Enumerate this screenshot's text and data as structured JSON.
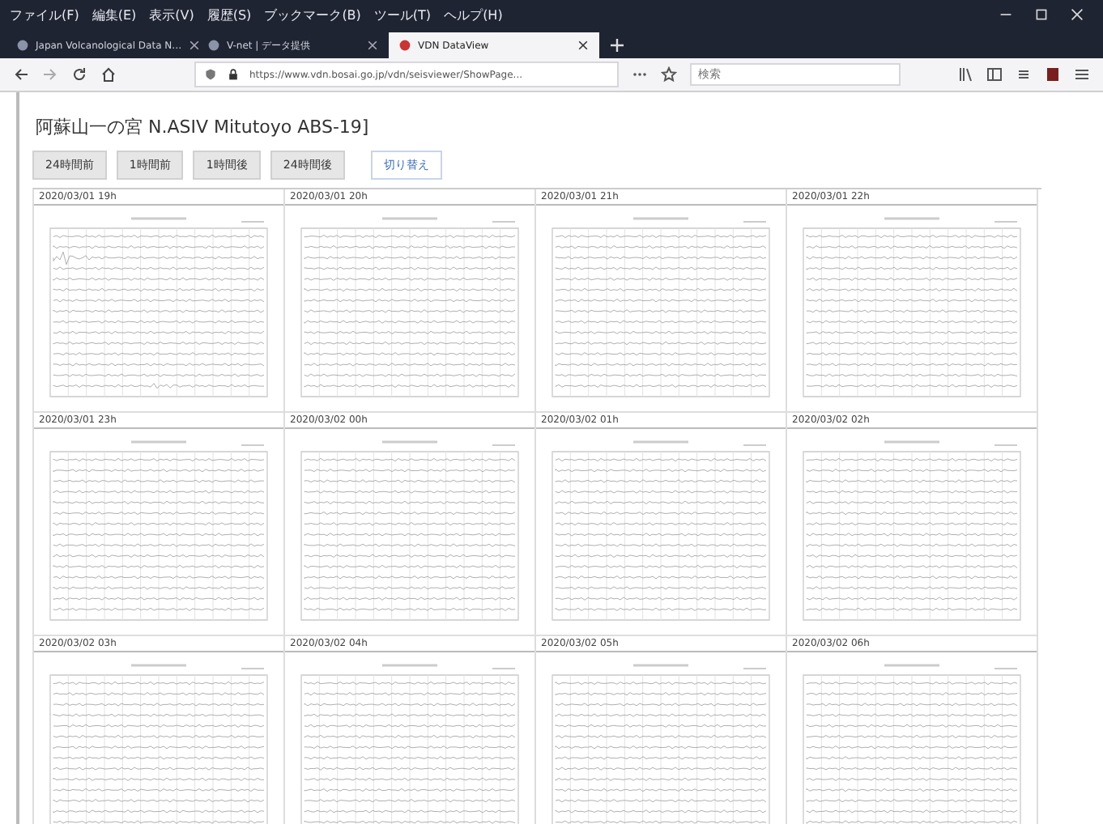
{
  "browser": {
    "menu": [
      "ファイル(F)",
      "編集(E)",
      "表示(V)",
      "履歴(S)",
      "ブックマーク(B)",
      "ツール(T)",
      "ヘルプ(H)"
    ],
    "tabs": [
      {
        "title": "Japan Volcanological Data N…",
        "selected": false
      },
      {
        "title": "V-net | データ提供",
        "selected": false
      },
      {
        "title": "VDN DataView",
        "selected": true
      }
    ],
    "address": "https://www.vdn.bosai.go.jp/vdn/seisviewer/ShowPage...",
    "search": {
      "placeholder": "検索"
    }
  },
  "page": {
    "title": "阿蘇山一の宮 N.ASIV Mitutoyo ABS-19]",
    "buttons": [
      {
        "label": "24時間前",
        "selected": false
      },
      {
        "label": "1時間前",
        "selected": false
      },
      {
        "label": "1時間後",
        "selected": false
      },
      {
        "label": "24時間後",
        "selected": false
      },
      {
        "label": "切り替え",
        "selected": true
      }
    ],
    "panels": [
      {
        "time": "2020/03/01 19h"
      },
      {
        "time": "2020/03/01 20h"
      },
      {
        "time": "2020/03/01 21h"
      },
      {
        "time": "2020/03/01 22h"
      },
      {
        "time": "2020/03/01 23h"
      },
      {
        "time": "2020/03/02 00h"
      },
      {
        "time": "2020/03/02 01h"
      },
      {
        "time": "2020/03/02 02h"
      },
      {
        "time": "2020/03/02 03h"
      },
      {
        "time": "2020/03/02 04h"
      },
      {
        "time": "2020/03/02 05h"
      },
      {
        "time": "2020/03/02 06h"
      }
    ]
  }
}
